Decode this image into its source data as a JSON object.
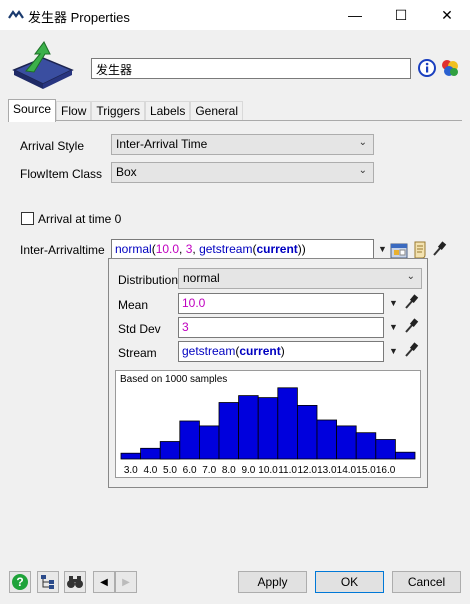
{
  "window": {
    "title": "发生器 Properties",
    "min_symbol": "—",
    "max_symbol": "☐",
    "close_symbol": "✕"
  },
  "header": {
    "object_name": "发生器"
  },
  "tabs": [
    {
      "label": "Source",
      "active": true
    },
    {
      "label": "Flow"
    },
    {
      "label": "Triggers"
    },
    {
      "label": "Labels"
    },
    {
      "label": "General"
    }
  ],
  "source": {
    "arrival_style_label": "Arrival Style",
    "arrival_style_value": "Inter-Arrival Time",
    "flowitem_class_label": "FlowItem Class",
    "flowitem_class_value": "Box",
    "arrival_at_time_zero_label": "Arrival at time 0",
    "arrival_at_time_zero_checked": false,
    "inter_arrivaltime_label": "Inter-Arrivaltime",
    "inter_arrivaltime_code": {
      "fn": "normal",
      "open": "(",
      "mean": "10.0",
      "sep1": ", ",
      "std": "3",
      "sep2": ", ",
      "stream_fn": "getstream",
      "stream_open": "(",
      "stream_arg": "current",
      "close": "))"
    }
  },
  "popup": {
    "distribution_label": "Distribution",
    "distribution_value": "normal",
    "mean_label": "Mean",
    "mean_value": "10.0",
    "stddev_label": "Std Dev",
    "stddev_value": "3",
    "stream_label": "Stream",
    "stream_fn": "getstream",
    "stream_open": "(",
    "stream_arg": "current",
    "stream_close": ")"
  },
  "chart_data": {
    "type": "bar",
    "title": "Based on 1000 samples",
    "categories": [
      "3.0",
      "4.0",
      "5.0",
      "6.0",
      "7.0",
      "8.0",
      "9.0",
      "10.0",
      "11.0",
      "12.0",
      "13.0",
      "14.0",
      "15.0",
      "16.0"
    ],
    "values": [
      6,
      11,
      18,
      39,
      34,
      58,
      65,
      63,
      73,
      55,
      40,
      34,
      27,
      20,
      7
    ],
    "bar_color": "#0000dd",
    "ylim": [
      0,
      80
    ]
  },
  "buttons": {
    "apply": "Apply",
    "ok": "OK",
    "cancel": "Cancel"
  },
  "colors": {
    "keyword": "#0000c0",
    "number": "#c000c0",
    "bars": "#0000dd"
  }
}
